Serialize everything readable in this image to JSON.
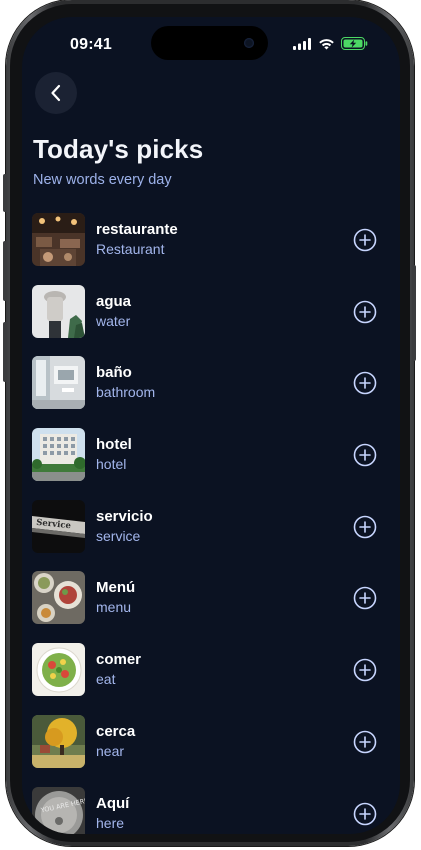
{
  "status_bar": {
    "time": "09:41",
    "icons": [
      "cellular-signal-icon",
      "wifi-icon",
      "battery-charging-icon"
    ],
    "battery_color": "#4cd964"
  },
  "header": {
    "back_icon": "chevron-left-icon",
    "title": "Today's picks",
    "subtitle": "New words every day"
  },
  "words": [
    {
      "word": "restaurante",
      "translation": "Restaurant",
      "image": "restaurant-photo"
    },
    {
      "word": "agua",
      "translation": "water",
      "image": "water-photo"
    },
    {
      "word": "baño",
      "translation": "bathroom",
      "image": "bathroom-photo"
    },
    {
      "word": "hotel",
      "translation": "hotel",
      "image": "hotel-photo"
    },
    {
      "word": "servicio",
      "translation": "service",
      "image": "service-sign-photo"
    },
    {
      "word": "Menú",
      "translation": "menu",
      "image": "menu-food-photo"
    },
    {
      "word": "comer",
      "translation": "eat",
      "image": "salad-photo"
    },
    {
      "word": "cerca",
      "translation": "near",
      "image": "tree-photo"
    },
    {
      "word": "Aquí",
      "translation": "here",
      "image": "you-are-here-photo"
    }
  ],
  "add_icon": "plus-circle-icon",
  "colors": {
    "background": "#0b1222",
    "subtitle": "#9db2ea",
    "accent": "#a3b6ec"
  }
}
